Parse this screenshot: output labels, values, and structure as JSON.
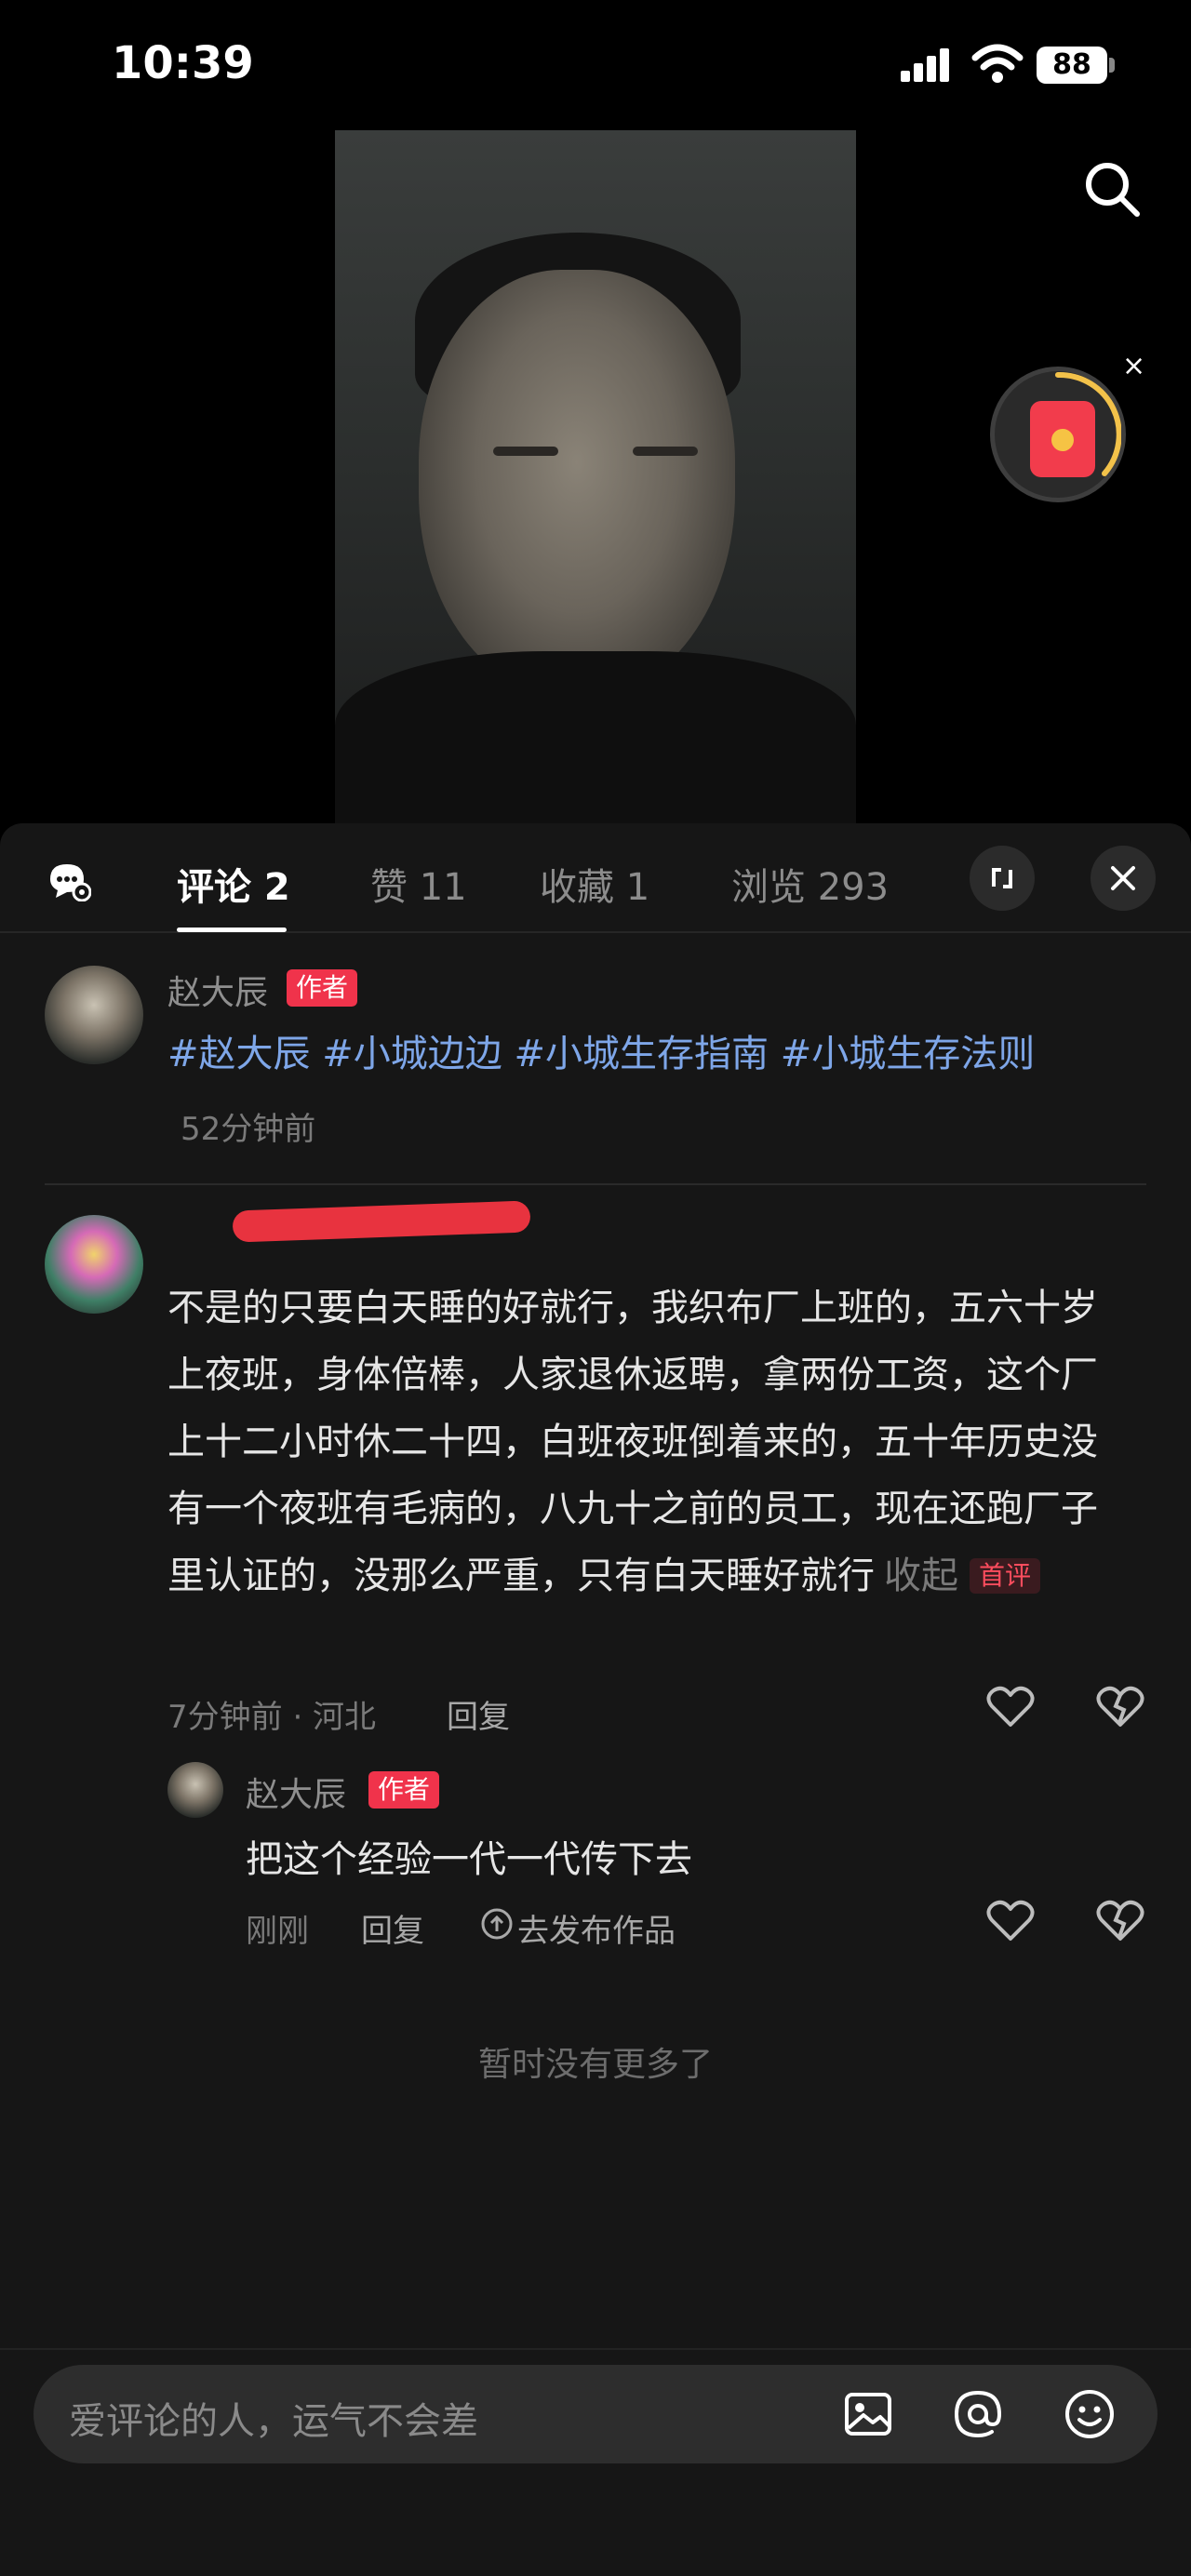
{
  "status_bar": {
    "time": "10:39",
    "battery": "88"
  },
  "video": {
    "red_packet_close": "×"
  },
  "tabs": {
    "comments": "评论 2",
    "likes": "赞 11",
    "favorites": "收藏 1",
    "views": "浏览 293"
  },
  "post": {
    "author": "赵大辰",
    "author_badge": "作者",
    "hashtags": "#赵大辰 #小城边边 #小城生存指南 #小城生存法则",
    "time": "52分钟前"
  },
  "comment": {
    "text": "不是的只要白天睡的好就行，我织布厂上班的，五六十岁上夜班，身体倍棒，人家退休返聘，拿两份工资，这个厂上十二小时休二十四，白班夜班倒着来的，五十年历史没有一个夜班有毛病的，八九十之前的员工，现在还跑厂子里认证的，没那么严重，只有白天睡好就行",
    "collapse": "收起",
    "first_badge": "首评",
    "meta": "7分钟前 · 河北",
    "reply": "回复"
  },
  "reply": {
    "author": "赵大辰",
    "author_badge": "作者",
    "text": "把这个经验一代一代传下去",
    "time": "刚刚",
    "reply": "回复",
    "publish": "去发布作品"
  },
  "no_more": "暂时没有更多了",
  "input": {
    "placeholder": "爱评论的人，运气不会差"
  },
  "colors": {
    "accent": "#f0334b",
    "hashtag": "#7ea6e8",
    "panel_bg": "#161616"
  }
}
